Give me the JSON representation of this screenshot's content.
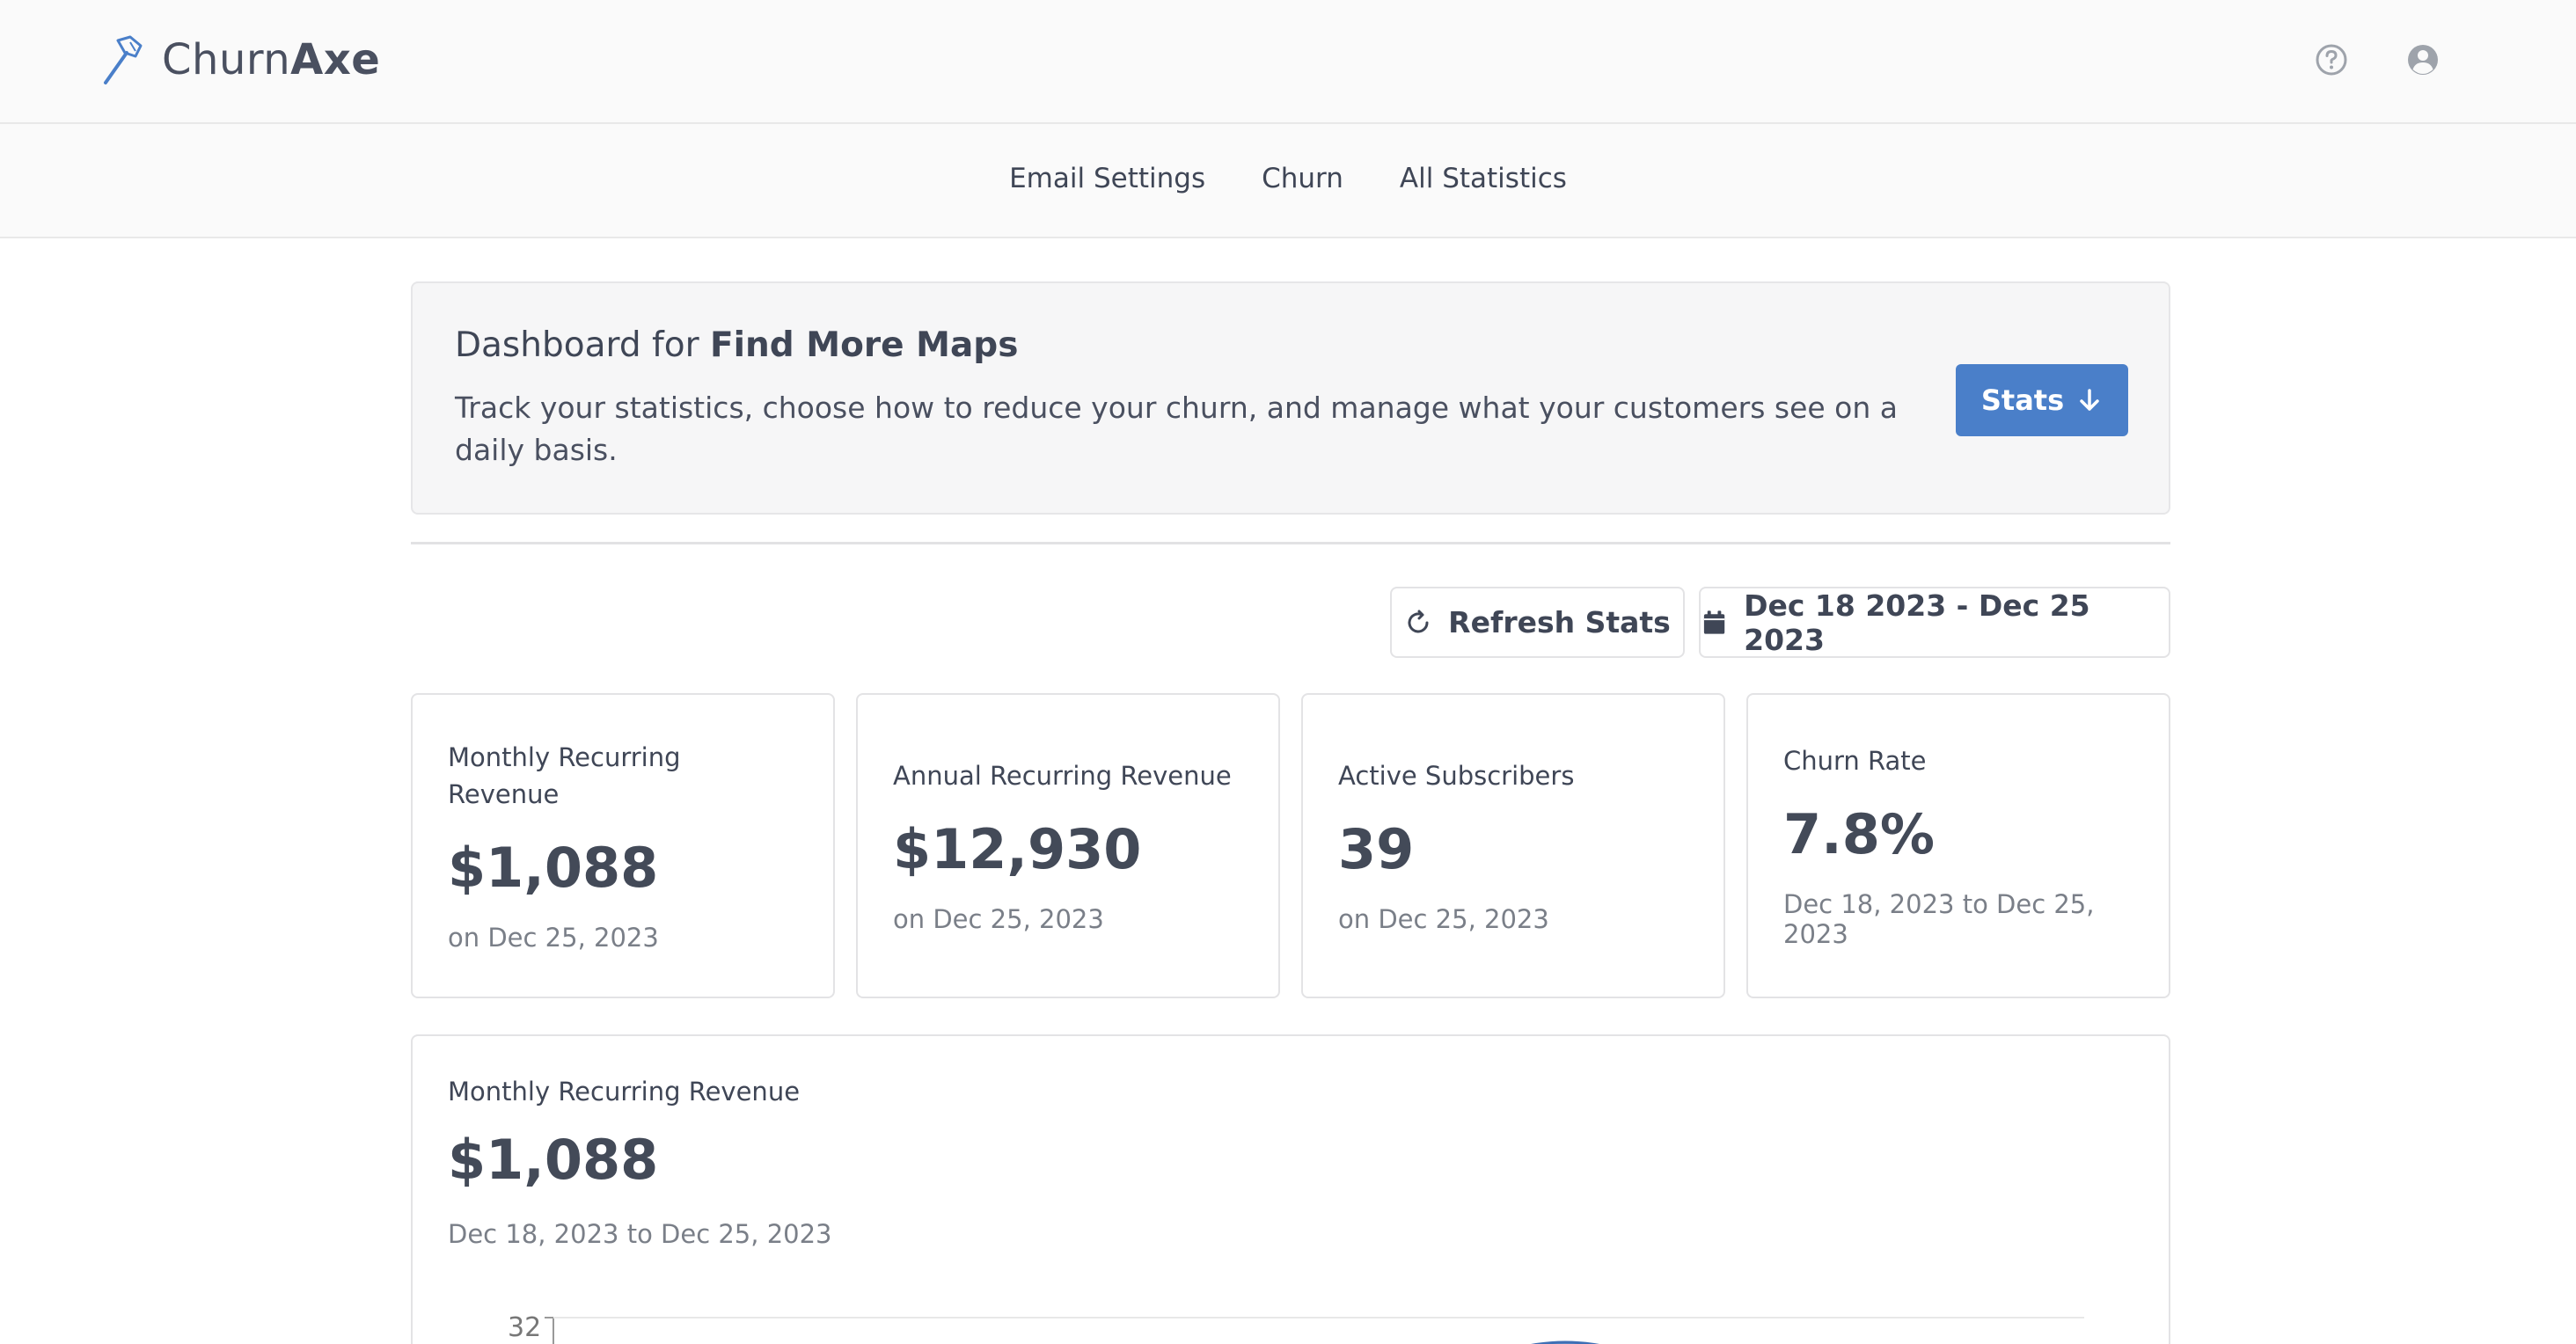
{
  "header": {
    "brand_regular": "Churn",
    "brand_bold": "Axe",
    "icons": [
      "axe-icon",
      "help-icon",
      "user-icon"
    ]
  },
  "nav": {
    "items": [
      {
        "label": "Email Settings"
      },
      {
        "label": "Churn"
      },
      {
        "label": "All Statistics"
      }
    ]
  },
  "hero": {
    "title_prefix": "Dashboard for ",
    "title_bold": "Find More Maps",
    "description": "Track your statistics, choose how to reduce your churn, and manage what your customers see on a daily basis.",
    "stats_button": "Stats"
  },
  "toolbar": {
    "refresh_label": "Refresh Stats",
    "date_range": "Dec 18 2023 - Dec 25 2023"
  },
  "cards": [
    {
      "label": "Monthly Recurring Revenue",
      "value": "$1,088",
      "sub": "on Dec 25, 2023"
    },
    {
      "label": "Annual Recurring Revenue",
      "value": "$12,930",
      "sub": "on Dec 25, 2023"
    },
    {
      "label": "Active Subscribers",
      "value": "39",
      "sub": "on Dec 25, 2023"
    },
    {
      "label": "Churn Rate",
      "value": "7.8%",
      "sub": "Dec 18, 2023 to Dec 25, 2023"
    }
  ],
  "mrr_panel": {
    "label": "Monthly Recurring Revenue",
    "value": "$1,088",
    "sub": "Dec 18, 2023 to Dec 25, 2023",
    "y_tick_top": "32"
  },
  "colors": {
    "accent": "#4a7fc9",
    "chart_fill": "#5b86c4"
  }
}
